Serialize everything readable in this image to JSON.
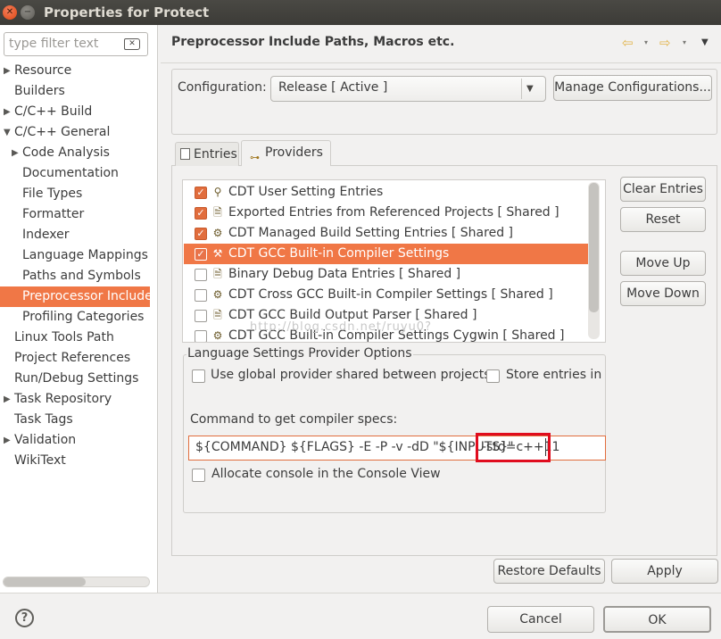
{
  "window": {
    "title": "Properties for Protect",
    "close_glyph": "✕",
    "minimize_glyph": "−"
  },
  "sidebar": {
    "filter_placeholder": "type filter text",
    "filter_clear_glyph": "✕",
    "items": [
      {
        "label": "Resource",
        "expandable": true,
        "expanded": false
      },
      {
        "label": "Builders",
        "expandable": false
      },
      {
        "label": "C/C++ Build",
        "expandable": true,
        "expanded": false
      },
      {
        "label": "C/C++ General",
        "expandable": true,
        "expanded": true
      },
      {
        "label": "Code Analysis",
        "expandable": true,
        "expanded": false
      },
      {
        "label": "Documentation",
        "expandable": false
      },
      {
        "label": "File Types",
        "expandable": false
      },
      {
        "label": "Formatter",
        "expandable": false
      },
      {
        "label": "Indexer",
        "expandable": false
      },
      {
        "label": "Language Mappings",
        "expandable": false
      },
      {
        "label": "Paths and Symbols",
        "expandable": false
      },
      {
        "label": "Preprocessor Include",
        "expandable": false,
        "selected": true
      },
      {
        "label": "Profiling Categories",
        "expandable": false
      },
      {
        "label": "Linux Tools Path",
        "expandable": false
      },
      {
        "label": "Project References",
        "expandable": false
      },
      {
        "label": "Run/Debug Settings",
        "expandable": false
      },
      {
        "label": "Task Repository",
        "expandable": true,
        "expanded": false
      },
      {
        "label": "Task Tags",
        "expandable": false
      },
      {
        "label": "Validation",
        "expandable": true,
        "expanded": false
      },
      {
        "label": "WikiText",
        "expandable": false
      }
    ]
  },
  "header": {
    "page_title": "Preprocessor Include Paths, Macros etc.",
    "back_glyph": "⇦",
    "forward_glyph": "⇨",
    "dropdown_glyph": "▾",
    "menu_glyph": "▼"
  },
  "config": {
    "label": "Configuration:",
    "selected": "Release  [ Active ]",
    "arrow_glyph": "▼",
    "manage_button": "Manage Configurations..."
  },
  "tabs": {
    "entries": "Entries",
    "providers": "Providers",
    "providers_icon": "⊶"
  },
  "providers": [
    {
      "label": "CDT User Setting Entries",
      "checked": true,
      "icon": "user-setting-icon",
      "glyph": "⚲"
    },
    {
      "label": "Exported Entries from Referenced Projects   [ Shared ]",
      "checked": true,
      "icon": "exported-entries-icon",
      "glyph": "🗎"
    },
    {
      "label": "CDT Managed Build Setting Entries   [ Shared ]",
      "checked": true,
      "icon": "managed-build-icon",
      "glyph": "⚙"
    },
    {
      "label": "CDT GCC Built-in Compiler Settings",
      "checked": true,
      "selected": true,
      "icon": "gcc-builtin-icon",
      "glyph": "⚒"
    },
    {
      "label": "Binary Debug Data Entries   [ Shared ]",
      "checked": false,
      "icon": "binary-debug-icon",
      "glyph": "🗎"
    },
    {
      "label": "CDT Cross GCC Built-in Compiler Settings   [ Shared ]",
      "checked": false,
      "icon": "cross-gcc-icon",
      "glyph": "⚙"
    },
    {
      "label": "CDT GCC Build Output Parser   [ Shared ]",
      "checked": false,
      "icon": "output-parser-icon",
      "glyph": "🗎"
    },
    {
      "label": "CDT GCC Built-in Compiler Settings Cygwin   [ Shared ]",
      "checked": false,
      "icon": "cygwin-icon",
      "glyph": "⚙"
    }
  ],
  "watermark": "http://blog.csdn.net/ruyu0?",
  "side_buttons": {
    "clear": "Clear Entries",
    "reset": "Reset",
    "move_up": "Move Up",
    "move_down": "Move Down"
  },
  "options": {
    "legend": "Language Settings Provider Options",
    "use_global": "Use global provider shared between projects",
    "store_entries": "Store entries in p",
    "command_label": "Command to get compiler specs:",
    "command_prefix": "${COMMAND} ${FLAGS} -E -P -v -dD \"${INPUTS}\"",
    "command_highlight": " -std=c++11",
    "allocate_console": "Allocate console in the Console View"
  },
  "footer": {
    "restore": "Restore Defaults",
    "apply": "Apply",
    "cancel": "Cancel",
    "ok": "OK",
    "help_glyph": "?"
  },
  "colors": {
    "selection": "#f07746",
    "highlight_box": "#e00d1e",
    "checkbox_checked": "#e16d3d"
  }
}
